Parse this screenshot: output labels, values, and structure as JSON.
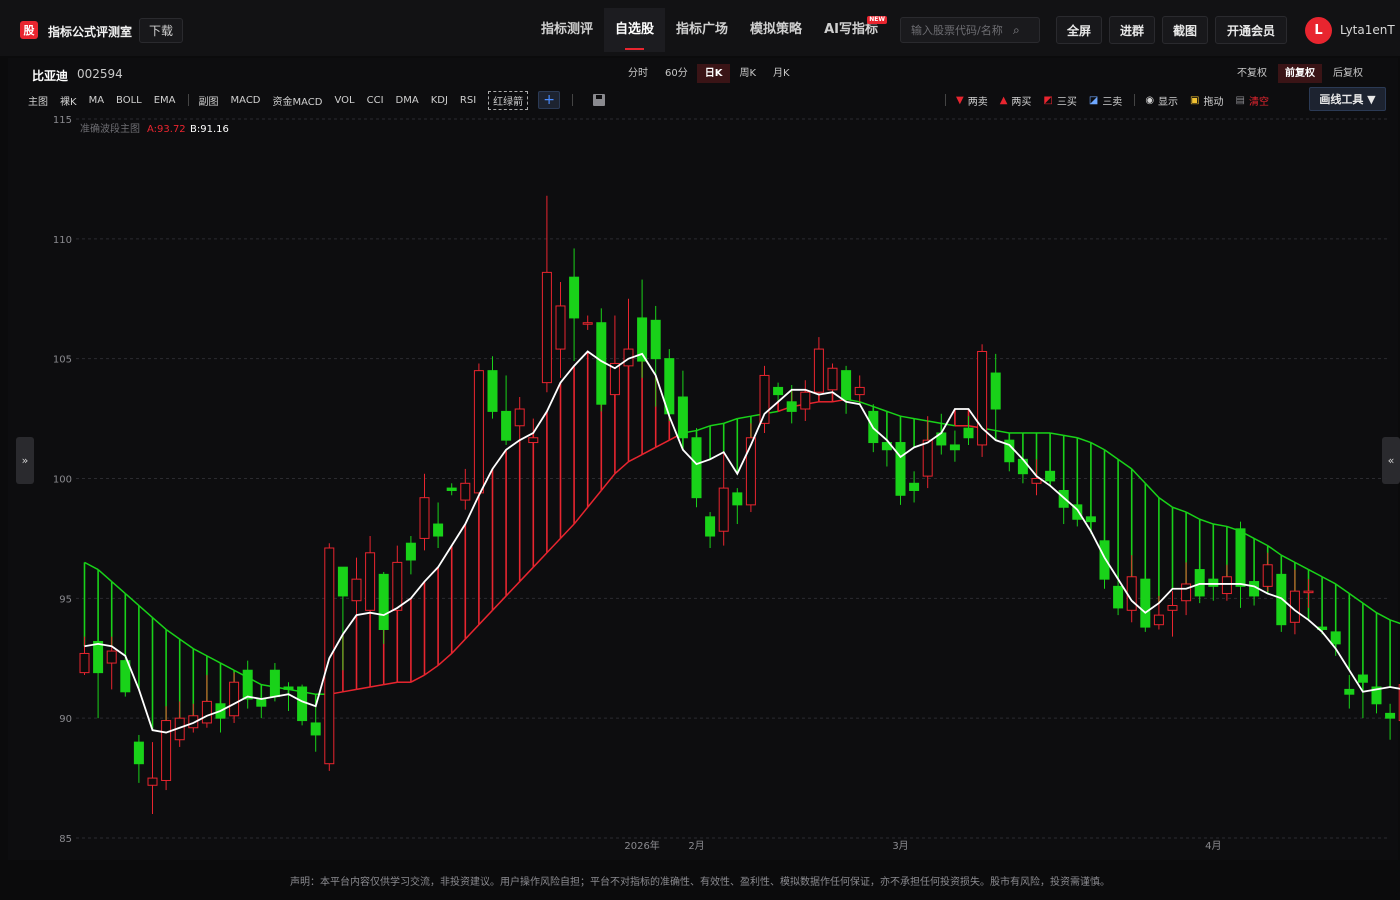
{
  "topbar": {
    "logo_char": "股",
    "title": "指标公式评测室",
    "download": "下载",
    "nav": [
      "指标测评",
      "自选股",
      "指标广场",
      "模拟策略",
      "AI写指标"
    ],
    "nav_active": 1,
    "new_badge": "NEW",
    "search_placeholder": "输入股票代码/名称",
    "buttons": [
      "全屏",
      "进群",
      "截图",
      "开通会员"
    ],
    "avatar": "L",
    "username": "Lyta1enT"
  },
  "stock": {
    "name": "比亚迪",
    "code": "002594"
  },
  "period_tabs": [
    "分时",
    "60分",
    "日K",
    "周K",
    "月K"
  ],
  "period_active": 2,
  "adjust_tabs": [
    "不复权",
    "前复权",
    "后复权"
  ],
  "adjust_active": 1,
  "indicators": {
    "main": [
      "主图",
      "裸K",
      "MA",
      "BOLL",
      "EMA"
    ],
    "sub": [
      "副图",
      "MACD",
      "资金MACD",
      "VOL",
      "CCI",
      "DMA",
      "KDJ",
      "RSI",
      "红绿箭"
    ],
    "plus": "+"
  },
  "draw_tools": {
    "items": [
      "两卖",
      "两买",
      "三买",
      "三卖",
      "显示",
      "拖动",
      "清空"
    ],
    "menu": "画线工具 ▼"
  },
  "side_left": "»",
  "side_right": "«",
  "legend": {
    "name": "准确波段主图",
    "a_label": "A:93.72",
    "b_label": "B:91.16"
  },
  "colors": {
    "up": "#e8252f",
    "down": "#19d219",
    "white_line": "#ffffff",
    "magenta": "#ff00ff",
    "accent": "#e8252f"
  },
  "footer": "声明：本平台内容仅供学习交流，非投资建议。用户操作风险自担；平台不对指标的准确性、有效性、盈利性、模拟数据作任何保证，亦不承担任何投资损失。股市有风险，投资需谨慎。",
  "chart_data": {
    "type": "candlestick",
    "y_ticks": [
      115,
      110,
      105,
      100,
      95,
      90,
      85
    ],
    "ylim": [
      85,
      115
    ],
    "x_labels": [
      {
        "index": 41,
        "text": "2026年"
      },
      {
        "index": 45,
        "text": "2月"
      },
      {
        "index": 60,
        "text": "3月"
      },
      {
        "index": 83,
        "text": "4月"
      }
    ],
    "candles": [
      {
        "o": 91.9,
        "c": 92.7,
        "h": 93.4,
        "l": 91.8
      },
      {
        "o": 93.2,
        "c": 91.9,
        "h": 93.6,
        "l": 90.0
      },
      {
        "o": 92.3,
        "c": 92.8,
        "h": 93.4,
        "l": 91.2
      },
      {
        "o": 92.4,
        "c": 91.1,
        "h": 92.6,
        "l": 90.9
      },
      {
        "o": 89.0,
        "c": 88.1,
        "h": 89.3,
        "l": 87.3
      },
      {
        "o": 87.2,
        "c": 87.5,
        "h": 89.0,
        "l": 86.0
      },
      {
        "o": 87.4,
        "c": 89.9,
        "h": 90.5,
        "l": 87.0
      },
      {
        "o": 89.1,
        "c": 90.0,
        "h": 90.7,
        "l": 88.8
      },
      {
        "o": 89.6,
        "c": 90.1,
        "h": 90.6,
        "l": 89.4
      },
      {
        "o": 89.8,
        "c": 90.7,
        "h": 91.8,
        "l": 89.6
      },
      {
        "o": 90.6,
        "c": 90.0,
        "h": 90.9,
        "l": 89.4
      },
      {
        "o": 90.1,
        "c": 91.5,
        "h": 91.9,
        "l": 89.8
      },
      {
        "o": 92.0,
        "c": 90.8,
        "h": 92.4,
        "l": 90.4
      },
      {
        "o": 90.8,
        "c": 90.5,
        "h": 91.0,
        "l": 90.0
      },
      {
        "o": 92.0,
        "c": 90.9,
        "h": 92.3,
        "l": 90.7
      },
      {
        "o": 91.3,
        "c": 91.2,
        "h": 91.5,
        "l": 90.3
      },
      {
        "o": 91.3,
        "c": 89.9,
        "h": 91.4,
        "l": 89.7
      },
      {
        "o": 89.8,
        "c": 89.3,
        "h": 90.5,
        "l": 88.6
      },
      {
        "o": 88.1,
        "c": 97.1,
        "h": 97.3,
        "l": 87.8
      },
      {
        "o": 96.3,
        "c": 95.1,
        "h": 96.3,
        "l": 92.0
      },
      {
        "o": 94.9,
        "c": 95.8,
        "h": 96.7,
        "l": 94.0
      },
      {
        "o": 94.5,
        "c": 96.9,
        "h": 97.6,
        "l": 93.4
      },
      {
        "o": 96.0,
        "c": 93.7,
        "h": 96.1,
        "l": 93.1
      },
      {
        "o": 94.5,
        "c": 96.5,
        "h": 97.2,
        "l": 94.0
      },
      {
        "o": 97.3,
        "c": 96.6,
        "h": 97.6,
        "l": 96.0
      },
      {
        "o": 97.5,
        "c": 99.2,
        "h": 100.2,
        "l": 97.0
      },
      {
        "o": 98.1,
        "c": 97.6,
        "h": 99.0,
        "l": 97.1
      },
      {
        "o": 99.6,
        "c": 99.5,
        "h": 99.8,
        "l": 99.3
      },
      {
        "o": 99.1,
        "c": 99.8,
        "h": 100.4,
        "l": 98.7
      },
      {
        "o": 99.4,
        "c": 104.5,
        "h": 104.8,
        "l": 99.0
      },
      {
        "o": 104.5,
        "c": 102.8,
        "h": 105.1,
        "l": 102.5
      },
      {
        "o": 102.8,
        "c": 101.6,
        "h": 104.3,
        "l": 101.4
      },
      {
        "o": 102.2,
        "c": 102.9,
        "h": 103.4,
        "l": 101.2
      },
      {
        "o": 101.5,
        "c": 101.7,
        "h": 102.5,
        "l": 101.3
      },
      {
        "o": 104.0,
        "c": 108.6,
        "h": 111.8,
        "l": 103.6
      },
      {
        "o": 105.4,
        "c": 107.2,
        "h": 108.2,
        "l": 104.2
      },
      {
        "o": 108.4,
        "c": 106.7,
        "h": 109.6,
        "l": 104.9
      },
      {
        "o": 106.5,
        "c": 106.5,
        "h": 106.8,
        "l": 106.2
      },
      {
        "o": 106.5,
        "c": 103.1,
        "h": 107.1,
        "l": 102.8
      },
      {
        "o": 103.5,
        "c": 104.8,
        "h": 106.8,
        "l": 103.0
      },
      {
        "o": 104.7,
        "c": 105.4,
        "h": 107.5,
        "l": 103.5
      },
      {
        "o": 106.7,
        "c": 104.9,
        "h": 108.3,
        "l": 104.2
      },
      {
        "o": 106.6,
        "c": 105.0,
        "h": 107.2,
        "l": 103.0
      },
      {
        "o": 105.0,
        "c": 102.7,
        "h": 105.4,
        "l": 102.4
      },
      {
        "o": 103.4,
        "c": 101.7,
        "h": 104.5,
        "l": 101.4
      },
      {
        "o": 101.7,
        "c": 99.2,
        "h": 102.1,
        "l": 98.8
      },
      {
        "o": 98.4,
        "c": 97.6,
        "h": 98.6,
        "l": 97.1
      },
      {
        "o": 97.8,
        "c": 99.6,
        "h": 101.1,
        "l": 97.2
      },
      {
        "o": 99.4,
        "c": 98.9,
        "h": 99.6,
        "l": 98.1
      },
      {
        "o": 98.9,
        "c": 101.7,
        "h": 102.3,
        "l": 98.6
      },
      {
        "o": 102.3,
        "c": 104.3,
        "h": 104.7,
        "l": 101.9
      },
      {
        "o": 103.8,
        "c": 103.5,
        "h": 104.0,
        "l": 103.2
      },
      {
        "o": 103.2,
        "c": 102.8,
        "h": 103.9,
        "l": 102.3
      },
      {
        "o": 102.9,
        "c": 103.6,
        "h": 104.1,
        "l": 102.4
      },
      {
        "o": 103.6,
        "c": 105.4,
        "h": 105.9,
        "l": 103.4
      },
      {
        "o": 103.7,
        "c": 104.6,
        "h": 104.8,
        "l": 103.4
      },
      {
        "o": 104.5,
        "c": 103.3,
        "h": 104.7,
        "l": 102.7
      },
      {
        "o": 103.5,
        "c": 103.8,
        "h": 104.3,
        "l": 103.2
      },
      {
        "o": 102.8,
        "c": 101.5,
        "h": 103.1,
        "l": 101.1
      },
      {
        "o": 101.5,
        "c": 101.2,
        "h": 102.3,
        "l": 100.5
      },
      {
        "o": 101.5,
        "c": 99.3,
        "h": 101.8,
        "l": 98.9
      },
      {
        "o": 99.8,
        "c": 99.5,
        "h": 100.3,
        "l": 99.0
      },
      {
        "o": 100.1,
        "c": 101.6,
        "h": 102.6,
        "l": 99.6
      },
      {
        "o": 101.9,
        "c": 101.4,
        "h": 102.7,
        "l": 101.0
      },
      {
        "o": 101.4,
        "c": 101.2,
        "h": 102.0,
        "l": 100.7
      },
      {
        "o": 102.1,
        "c": 101.7,
        "h": 102.6,
        "l": 101.4
      },
      {
        "o": 101.4,
        "c": 105.3,
        "h": 105.6,
        "l": 100.9
      },
      {
        "o": 104.4,
        "c": 102.9,
        "h": 105.2,
        "l": 102.0
      },
      {
        "o": 101.6,
        "c": 100.7,
        "h": 101.8,
        "l": 100.3
      },
      {
        "o": 100.8,
        "c": 100.2,
        "h": 101.2,
        "l": 99.8
      },
      {
        "o": 99.8,
        "c": 100.0,
        "h": 100.8,
        "l": 99.3
      },
      {
        "o": 100.3,
        "c": 99.9,
        "h": 100.9,
        "l": 99.7
      },
      {
        "o": 99.5,
        "c": 98.8,
        "h": 100.4,
        "l": 98.1
      },
      {
        "o": 98.9,
        "c": 98.3,
        "h": 99.4,
        "l": 98.0
      },
      {
        "o": 98.4,
        "c": 98.2,
        "h": 98.9,
        "l": 97.7
      },
      {
        "o": 97.4,
        "c": 95.8,
        "h": 97.6,
        "l": 95.4
      },
      {
        "o": 95.5,
        "c": 94.6,
        "h": 96.0,
        "l": 94.3
      },
      {
        "o": 94.5,
        "c": 95.9,
        "h": 96.8,
        "l": 94.0
      },
      {
        "o": 95.8,
        "c": 93.8,
        "h": 96.2,
        "l": 93.6
      },
      {
        "o": 93.9,
        "c": 94.3,
        "h": 95.1,
        "l": 93.7
      },
      {
        "o": 94.5,
        "c": 94.7,
        "h": 95.3,
        "l": 93.4
      },
      {
        "o": 94.9,
        "c": 95.6,
        "h": 96.5,
        "l": 94.3
      },
      {
        "o": 96.2,
        "c": 95.1,
        "h": 96.6,
        "l": 94.8
      },
      {
        "o": 95.8,
        "c": 95.5,
        "h": 96.2,
        "l": 94.9
      },
      {
        "o": 95.2,
        "c": 95.9,
        "h": 96.4,
        "l": 94.9
      },
      {
        "o": 97.9,
        "c": 95.5,
        "h": 98.2,
        "l": 94.6
      },
      {
        "o": 95.7,
        "c": 95.1,
        "h": 96.4,
        "l": 94.7
      },
      {
        "o": 95.5,
        "c": 96.4,
        "h": 96.9,
        "l": 95.3
      },
      {
        "o": 96.0,
        "c": 93.9,
        "h": 96.3,
        "l": 93.6
      },
      {
        "o": 94.0,
        "c": 95.3,
        "h": 96.2,
        "l": 93.5
      },
      {
        "o": 95.3,
        "c": 95.3,
        "h": 95.8,
        "l": 94.6
      },
      {
        "o": 93.8,
        "c": 93.7,
        "h": 94.2,
        "l": 93.5
      },
      {
        "o": 93.6,
        "c": 93.1,
        "h": 94.0,
        "l": 92.6
      },
      {
        "o": 91.2,
        "c": 91.0,
        "h": 91.8,
        "l": 90.4
      },
      {
        "o": 91.8,
        "c": 91.5,
        "h": 92.1,
        "l": 90.0
      },
      {
        "o": 91.3,
        "c": 90.6,
        "h": 91.5,
        "l": 90.2
      },
      {
        "o": 90.2,
        "c": 90.0,
        "h": 90.6,
        "l": 89.1
      },
      {
        "o": 89.9,
        "c": 91.4,
        "h": 91.7,
        "l": 89.5
      },
      {
        "o": 91.6,
        "c": 90.8,
        "h": 91.9,
        "l": 90.6
      }
    ],
    "band": [
      96.5,
      96.2,
      95.7,
      95.2,
      94.7,
      94.2,
      93.7,
      93.3,
      92.9,
      92.6,
      92.3,
      92.0,
      91.7,
      91.4,
      91.3,
      91.2,
      91.1,
      91.0,
      91.0,
      91.1,
      91.2,
      91.3,
      91.4,
      91.5,
      91.5,
      91.8,
      92.2,
      92.7,
      93.3,
      93.9,
      94.5,
      95.1,
      95.7,
      96.3,
      96.9,
      97.5,
      98.1,
      98.8,
      99.5,
      100.2,
      100.7,
      101.0,
      101.3,
      101.6,
      101.9,
      102.0,
      102.2,
      102.3,
      102.5,
      102.6,
      102.7,
      102.8,
      103.0,
      103.1,
      103.2,
      103.2,
      103.3,
      103.2,
      103.0,
      102.8,
      102.6,
      102.5,
      102.4,
      102.3,
      102.2,
      102.2,
      102.1,
      102.0,
      101.9,
      101.9,
      101.9,
      101.9,
      101.8,
      101.7,
      101.5,
      101.2,
      100.8,
      100.4,
      99.8,
      99.2,
      98.8,
      98.6,
      98.3,
      98.1,
      98.0,
      97.8,
      97.5,
      97.2,
      96.8,
      96.5,
      96.2,
      95.9,
      95.6,
      95.2,
      94.8,
      94.4,
      94.1,
      93.9,
      93.7
    ],
    "white_line": [
      93.0,
      93.1,
      93.0,
      92.6,
      91.2,
      89.5,
      89.4,
      89.6,
      89.8,
      90.1,
      90.3,
      90.6,
      90.9,
      90.8,
      90.9,
      91.0,
      90.7,
      90.5,
      92.5,
      93.5,
      94.3,
      94.4,
      94.3,
      94.6,
      95.0,
      95.7,
      96.3,
      97.2,
      98.1,
      99.3,
      100.4,
      101.2,
      101.6,
      101.9,
      102.8,
      104.0,
      104.7,
      105.3,
      104.9,
      104.6,
      105.0,
      105.2,
      104.3,
      102.6,
      101.2,
      100.6,
      100.8,
      101.1,
      100.2,
      101.4,
      102.7,
      103.2,
      103.7,
      103.7,
      103.5,
      103.6,
      103.2,
      103.1,
      102.1,
      101.6,
      100.9,
      101.3,
      101.5,
      101.9,
      102.9,
      102.9,
      102.1,
      101.6,
      101.4,
      100.8,
      100.1,
      99.7,
      99.2,
      98.7,
      97.8,
      96.7,
      95.8,
      94.9,
      94.4,
      94.8,
      95.4,
      95.4,
      95.6,
      95.6,
      95.6,
      95.6,
      95.5,
      95.2,
      95.0,
      94.5,
      94.1,
      93.6,
      92.9,
      92.0,
      91.1,
      91.2,
      91.3,
      91.2,
      91.0
    ]
  }
}
